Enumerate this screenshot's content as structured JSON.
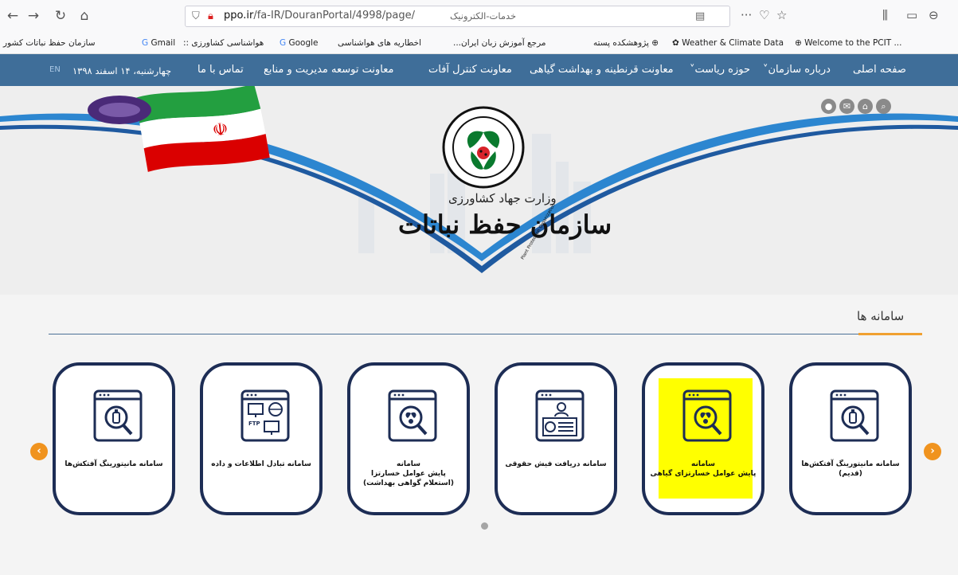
{
  "browser": {
    "url_domain": "ppo.ir",
    "url_path": "/fa-IR/DouranPortal/4998/page/",
    "url_title": "خدمات-الکترونیک",
    "bookmarks": [
      "Welcome to the PCIT ...",
      "Weather & Climate Data",
      "پژوهشکده پسته",
      "مرجع آموزش زبان ایران...",
      "اخطاریه های هواشناسی",
      "Google",
      "هواشناسی کشاورزی ::",
      "Gmail",
      "سازمان حفظ نباتات کشور"
    ]
  },
  "menu": {
    "items": [
      "صفحه اصلی",
      "درباره سازمان",
      "حوزه ریاست",
      "معاونت قرنطینه و بهداشت گیاهی",
      "معاونت کنترل آفات",
      "معاونت توسعه مدیریت و منابع",
      "تماس با ما"
    ],
    "date": "چهارشنبه، ۱۴ اسفند ۱۳۹۸",
    "lang": "EN"
  },
  "banner": {
    "ministry": "وزارت جهاد کشاورزی",
    "org": "سازمان حفظ نباتات",
    "seal_text": "Plant Protection Organization"
  },
  "section": {
    "title": "سامانه ها"
  },
  "cards": [
    {
      "label": "سامانه مانیتورینگ آفتکش‌ها\n(قدیم)",
      "icon": "pesticide-bottle-icon",
      "highlighted": false
    },
    {
      "label": "سامانه\nپایش عوامل خسارتزای گیاهی",
      "icon": "pest-magnifier-icon",
      "highlighted": true
    },
    {
      "label": "سامانه دریافت فیش حقوقی",
      "icon": "payslip-icon",
      "highlighted": false
    },
    {
      "label": "سامانه\nپایش عوامل خسارتزا\n(استعلام گواهی بهداشت)",
      "icon": "pest-magnifier-icon",
      "highlighted": false
    },
    {
      "label": "سامانه تبادل اطلاعات و داده",
      "icon": "ftp-exchange-icon",
      "highlighted": false
    },
    {
      "label": "سامانه مانیتورینگ آفتکش‌ها",
      "icon": "pesticide-bottle-icon",
      "highlighted": false
    }
  ],
  "colors": {
    "menu_bg": "#3f6e99",
    "card_border": "#1d2d55",
    "arrow": "#f0931e",
    "highlight": "#ffff00"
  }
}
